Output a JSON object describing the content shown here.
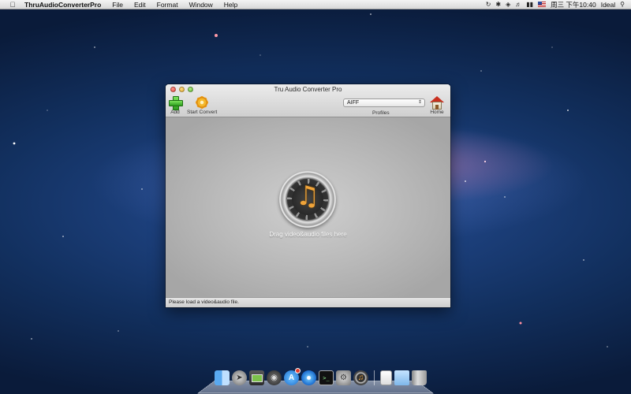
{
  "menubar": {
    "app_name": "ThruAudioConverterPro",
    "menus": [
      "File",
      "Edit",
      "Format",
      "Window",
      "Help"
    ],
    "clock": "周三 下午10:40",
    "user": "Ideal"
  },
  "window": {
    "title": "Tru Audio Converter Pro",
    "toolbar": {
      "add_label": "Add",
      "start_convert_label": "Start Convert",
      "home_label": "Home",
      "profiles_label": "Profiles",
      "profile_value": "AIFF"
    },
    "drop_text": "Drag video&audio files here",
    "status_text": "Please load a video&audio file."
  },
  "icons": {
    "add": "plus-icon",
    "start_convert": "gear-icon",
    "home": "house-icon",
    "drop_badge": "music-note-icon"
  },
  "dock": {
    "apps": [
      "finder",
      "launchpad",
      "mission-control",
      "dashboard",
      "app-store",
      "safari",
      "terminal",
      "system-preferences",
      "tru-audio-converter"
    ],
    "stacks": [
      "documents",
      "downloads",
      "trash"
    ]
  },
  "colors": {
    "accent_orange": "#f0a43a",
    "add_green": "#2e9d1f",
    "home_red": "#c9301f"
  }
}
